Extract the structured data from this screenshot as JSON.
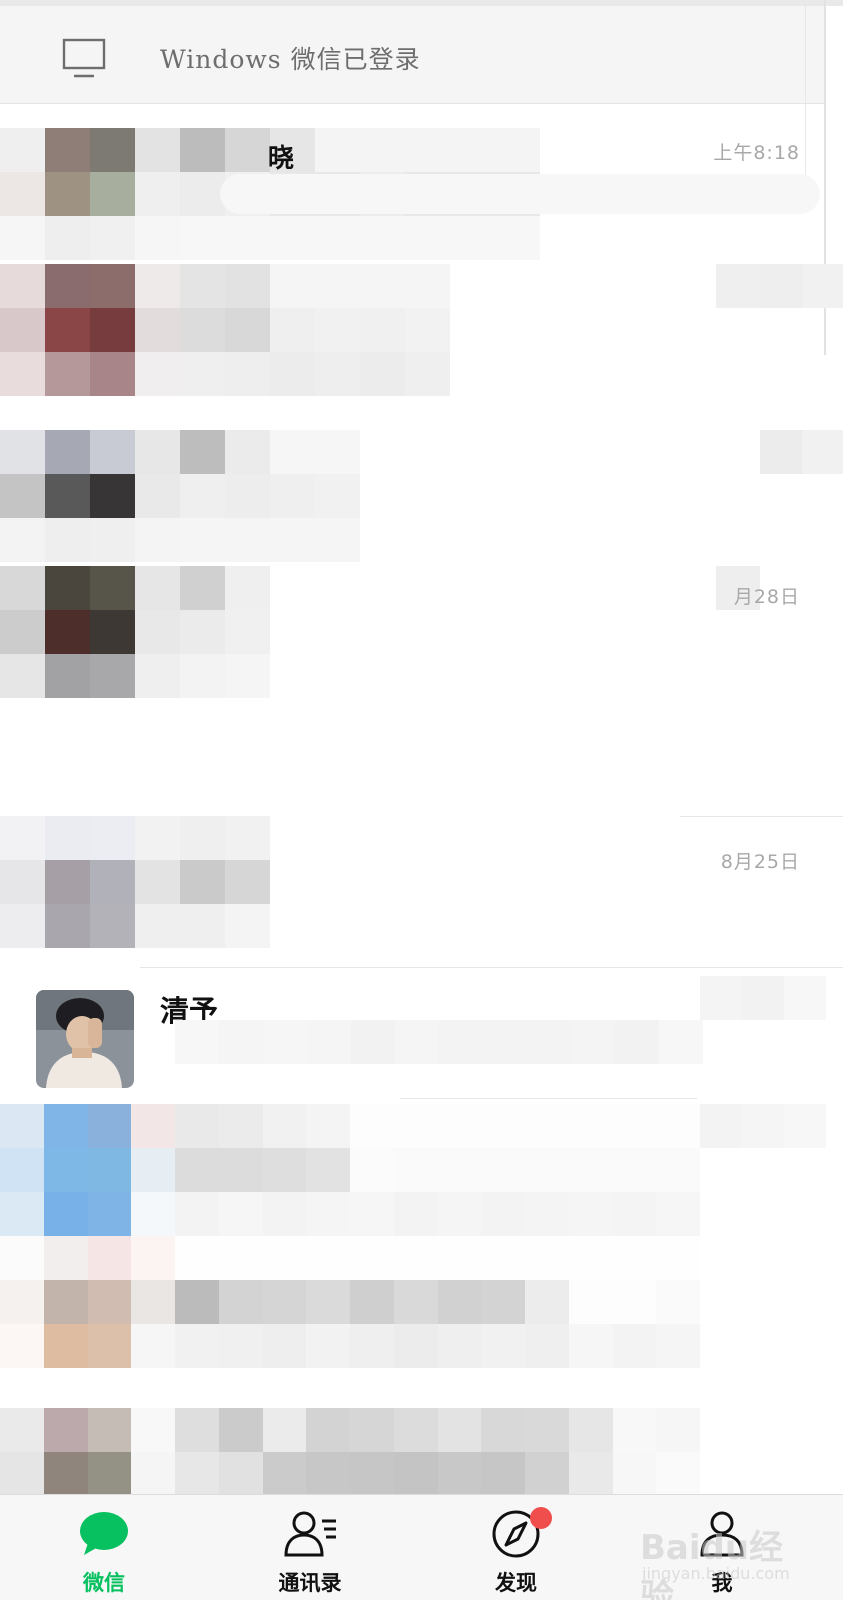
{
  "banner": {
    "icon": "monitor-icon",
    "text": "Windows 微信已登录"
  },
  "chats": [
    {
      "name": "晓",
      "time": "上午8:18",
      "obscured": true
    },
    {
      "name": "",
      "time": "",
      "obscured": true
    },
    {
      "name": "",
      "time": "",
      "obscured": true
    },
    {
      "name": "",
      "time": "月28日",
      "obscured": true
    },
    {
      "name": "",
      "time": "8月25日",
      "obscured": true
    },
    {
      "name": "清予",
      "time": "",
      "obscured": false
    },
    {
      "name": "",
      "time": "",
      "obscured": true
    },
    {
      "name": "",
      "time": "",
      "obscured": true
    },
    {
      "name": "",
      "time": "",
      "obscured": true
    }
  ],
  "tabs": [
    {
      "label": "微信",
      "icon": "chat-bubble-icon",
      "active": true
    },
    {
      "label": "通讯录",
      "icon": "contacts-icon",
      "active": false
    },
    {
      "label": "发现",
      "icon": "compass-icon",
      "active": false,
      "badge_dot": true
    },
    {
      "label": "我",
      "icon": "person-icon",
      "active": false
    }
  ],
  "watermark": {
    "main": "Baidu经验",
    "sub": "jingyan.baidu.com"
  },
  "colors": {
    "accent_green": "#07c160",
    "badge_red": "#f04d4d",
    "time_gray": "#a8a8a8"
  }
}
